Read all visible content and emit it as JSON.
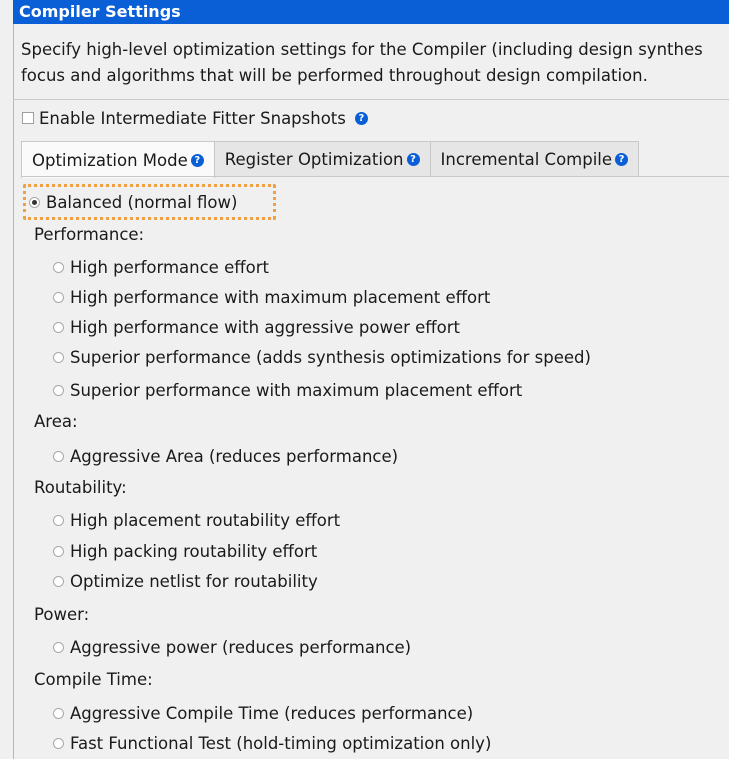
{
  "header": {
    "title": "Compiler Settings"
  },
  "description": {
    "line1": "Specify high-level optimization settings for the Compiler (including design synthes",
    "line2": "focus and algorithms that will be performed throughout design compilation."
  },
  "snapshots": {
    "label": "Enable Intermediate Fitter Snapshots",
    "checked": false
  },
  "tabs": [
    {
      "label": "Optimization Mode",
      "active": true
    },
    {
      "label": "Register Optimization",
      "active": false
    },
    {
      "label": "Incremental Compile",
      "active": false
    }
  ],
  "help_glyph": "?",
  "options": {
    "balanced": {
      "label": "Balanced (normal flow)",
      "selected": true
    },
    "performance": {
      "label": "Performance:",
      "items": [
        "High performance effort",
        "High performance with maximum placement effort",
        "High performance with aggressive power effort",
        "Superior performance (adds synthesis optimizations for speed)",
        "Superior performance with maximum placement effort"
      ]
    },
    "area": {
      "label": "Area:",
      "items": [
        "Aggressive Area (reduces performance)"
      ]
    },
    "routability": {
      "label": "Routability:",
      "items": [
        "High placement routability effort",
        "High packing routability effort",
        "Optimize netlist for routability"
      ]
    },
    "power": {
      "label": "Power:",
      "items": [
        "Aggressive power (reduces performance)"
      ]
    },
    "compile_time": {
      "label": "Compile Time:",
      "items": [
        "Aggressive Compile Time (reduces performance)",
        "Fast Functional Test (hold-timing optimization only)"
      ]
    }
  },
  "colors": {
    "title_bar": "#0a5fd6",
    "highlight": "#f0a040",
    "background": "#f0f0f0"
  }
}
